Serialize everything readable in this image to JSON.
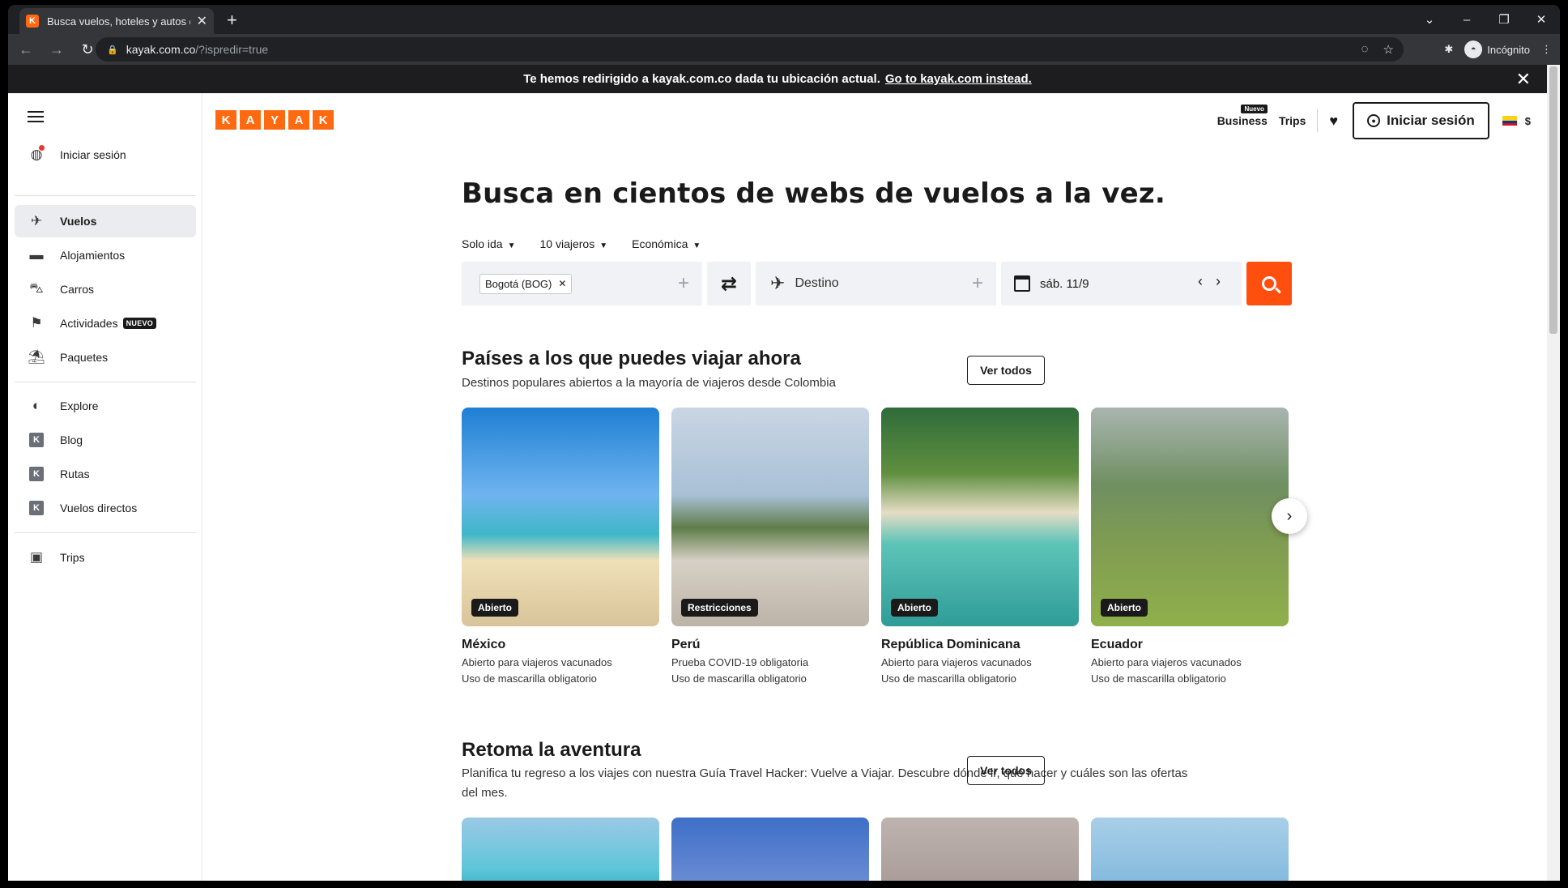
{
  "browser": {
    "tab_title": "Busca vuelos, hoteles y autos de",
    "tab_favicon": "K",
    "url_host": "kayak.com.co",
    "url_path": "/?ispredir=true",
    "profile": "Incógnito"
  },
  "banner": {
    "text": "Te hemos redirigido a kayak.com.co dada tu ubicación actual.",
    "link": "Go to kayak.com instead."
  },
  "sidebar": {
    "login": "Iniciar sesión",
    "items": [
      {
        "label": "Vuelos"
      },
      {
        "label": "Alojamientos"
      },
      {
        "label": "Carros"
      },
      {
        "label": "Actividades",
        "badge": "NUEVO"
      },
      {
        "label": "Paquetes"
      }
    ],
    "links": [
      {
        "label": "Explore"
      },
      {
        "label": "Blog"
      },
      {
        "label": "Rutas"
      },
      {
        "label": "Vuelos directos"
      }
    ],
    "trips": "Trips"
  },
  "header": {
    "logo": [
      "K",
      "A",
      "Y",
      "A",
      "K"
    ],
    "business": "Business",
    "business_tag": "Nuevo",
    "trips": "Trips",
    "login": "Iniciar sesión",
    "currency": "$"
  },
  "search": {
    "title": "Busca en cientos de webs de vuelos a la vez.",
    "trip_type": "Solo ida",
    "travelers": "10 viajeros",
    "cabin": "Económica",
    "origin": "Bogotá (BOG)",
    "destination": "Destino",
    "date": "sáb. 11/9"
  },
  "section1": {
    "title": "Países a los que puedes viajar ahora",
    "subtitle": "Destinos populares abiertos a la mayoría de viajeros desde Colombia",
    "view_all": "Ver todos",
    "cards": [
      {
        "badge": "Abierto",
        "name": "México",
        "line1": "Abierto para viajeros vacunados",
        "line2": "Uso de mascarilla obligatorio"
      },
      {
        "badge": "Restricciones",
        "name": "Perú",
        "line1": "Prueba COVID-19 obligatoria",
        "line2": "Uso de mascarilla obligatorio"
      },
      {
        "badge": "Abierto",
        "name": "República Dominicana",
        "line1": "Abierto para viajeros vacunados",
        "line2": "Uso de mascarilla obligatorio"
      },
      {
        "badge": "Abierto",
        "name": "Ecuador",
        "line1": "Abierto para viajeros vacunados",
        "line2": "Uso de mascarilla obligatorio"
      }
    ]
  },
  "section2": {
    "title": "Retoma la aventura",
    "subtitle": "Planifica tu regreso a los viajes con nuestra Guía Travel Hacker: Vuelve a Viajar. Descubre dónde ir, qué hacer y cuáles son las ofertas del mes.",
    "view_all": "Ver todos"
  },
  "colors": {
    "brand": "#ff690f",
    "search_button": "#ff4f0f"
  }
}
